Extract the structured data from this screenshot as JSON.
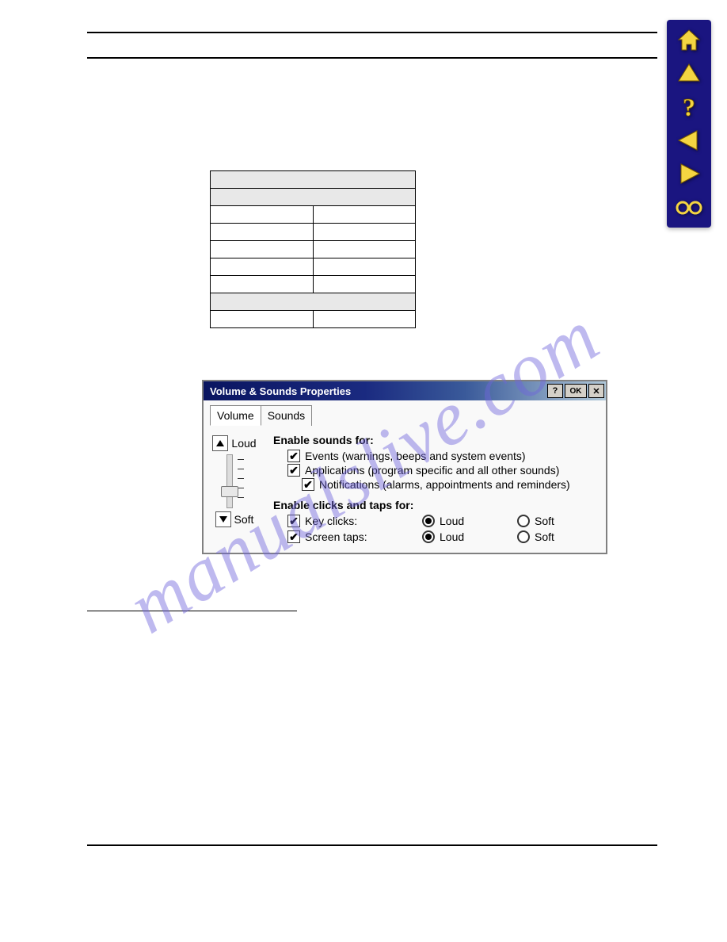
{
  "watermark": "manualslive.com",
  "dialog": {
    "title": "Volume & Sounds Properties",
    "help_label": "?",
    "ok_label": "OK",
    "close_label": "✕",
    "tabs": [
      "Volume",
      "Sounds"
    ],
    "active_tab": 0,
    "volume": {
      "loud_label": "Loud",
      "soft_label": "Soft"
    },
    "sounds_header": "Enable sounds for:",
    "checkboxes": [
      {
        "label": "Events (warnings, beeps and system events)",
        "checked": true
      },
      {
        "label": "Applications (program specific and all other sounds)",
        "checked": true
      },
      {
        "label": "Notifications (alarms, appointments and reminders)",
        "checked": true
      }
    ],
    "clicks_header": "Enable clicks and taps for:",
    "click_rows": [
      {
        "label": "Key clicks:",
        "checked": true,
        "loud_label": "Loud",
        "soft_label": "Soft",
        "selected": "loud"
      },
      {
        "label": "Screen taps:",
        "checked": true,
        "loud_label": "Loud",
        "soft_label": "Soft",
        "selected": "loud"
      }
    ]
  }
}
